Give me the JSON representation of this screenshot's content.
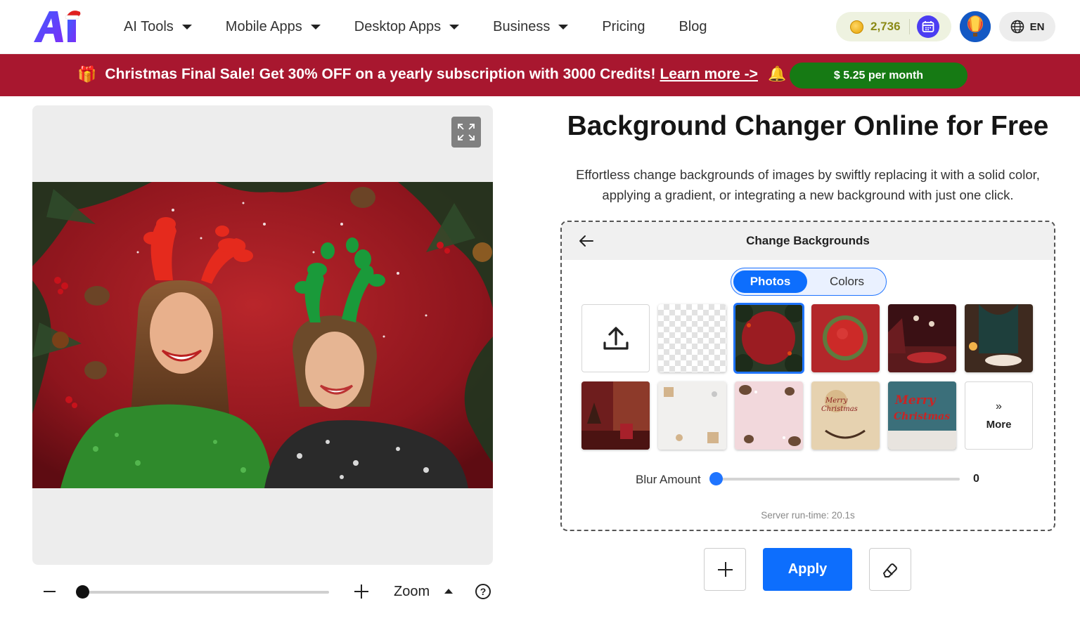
{
  "header": {
    "nav": [
      {
        "label": "AI Tools",
        "caret": true
      },
      {
        "label": "Mobile Apps",
        "caret": true
      },
      {
        "label": "Desktop Apps",
        "caret": true
      },
      {
        "label": "Business",
        "caret": true
      },
      {
        "label": "Pricing",
        "caret": false
      },
      {
        "label": "Blog",
        "caret": false
      }
    ],
    "credits": "2,736",
    "language": "EN"
  },
  "promo": {
    "text": "Christmas Final Sale! Get 30% OFF on a yearly subscription with 3000 Credits!",
    "link": "Learn more ->",
    "button": "$ 5.25 per month"
  },
  "editor": {
    "zoom_label": "Zoom",
    "zoom_level": 0.03,
    "help_glyph": "?"
  },
  "content": {
    "title": "Background Changer Online for Free",
    "description": "Effortless change backgrounds of images by swiftly replacing it with a solid color, applying a gradient, or integrating a new background with just one click."
  },
  "panel": {
    "title": "Change Backgrounds",
    "tabs": {
      "photos": "Photos",
      "colors": "Colors",
      "active": "Photos"
    },
    "more_label": "More",
    "blur_label": "Blur Amount",
    "blur_value": "0",
    "runtime": "Server run-time: 20.1s"
  },
  "actions": {
    "apply": "Apply"
  },
  "colors": {
    "accent": "#0d6efd",
    "promo_bg": "#a8172f",
    "promo_btn": "#167a14",
    "credits_text": "#8b8a16"
  },
  "icons": [
    "expand-icon",
    "back-arrow-icon",
    "upload-icon",
    "chevron-double-right-icon",
    "plus-icon",
    "eraser-icon",
    "help-icon",
    "globe-icon",
    "calendar-icon",
    "coin-icon",
    "gift-icon",
    "bell-icon"
  ]
}
